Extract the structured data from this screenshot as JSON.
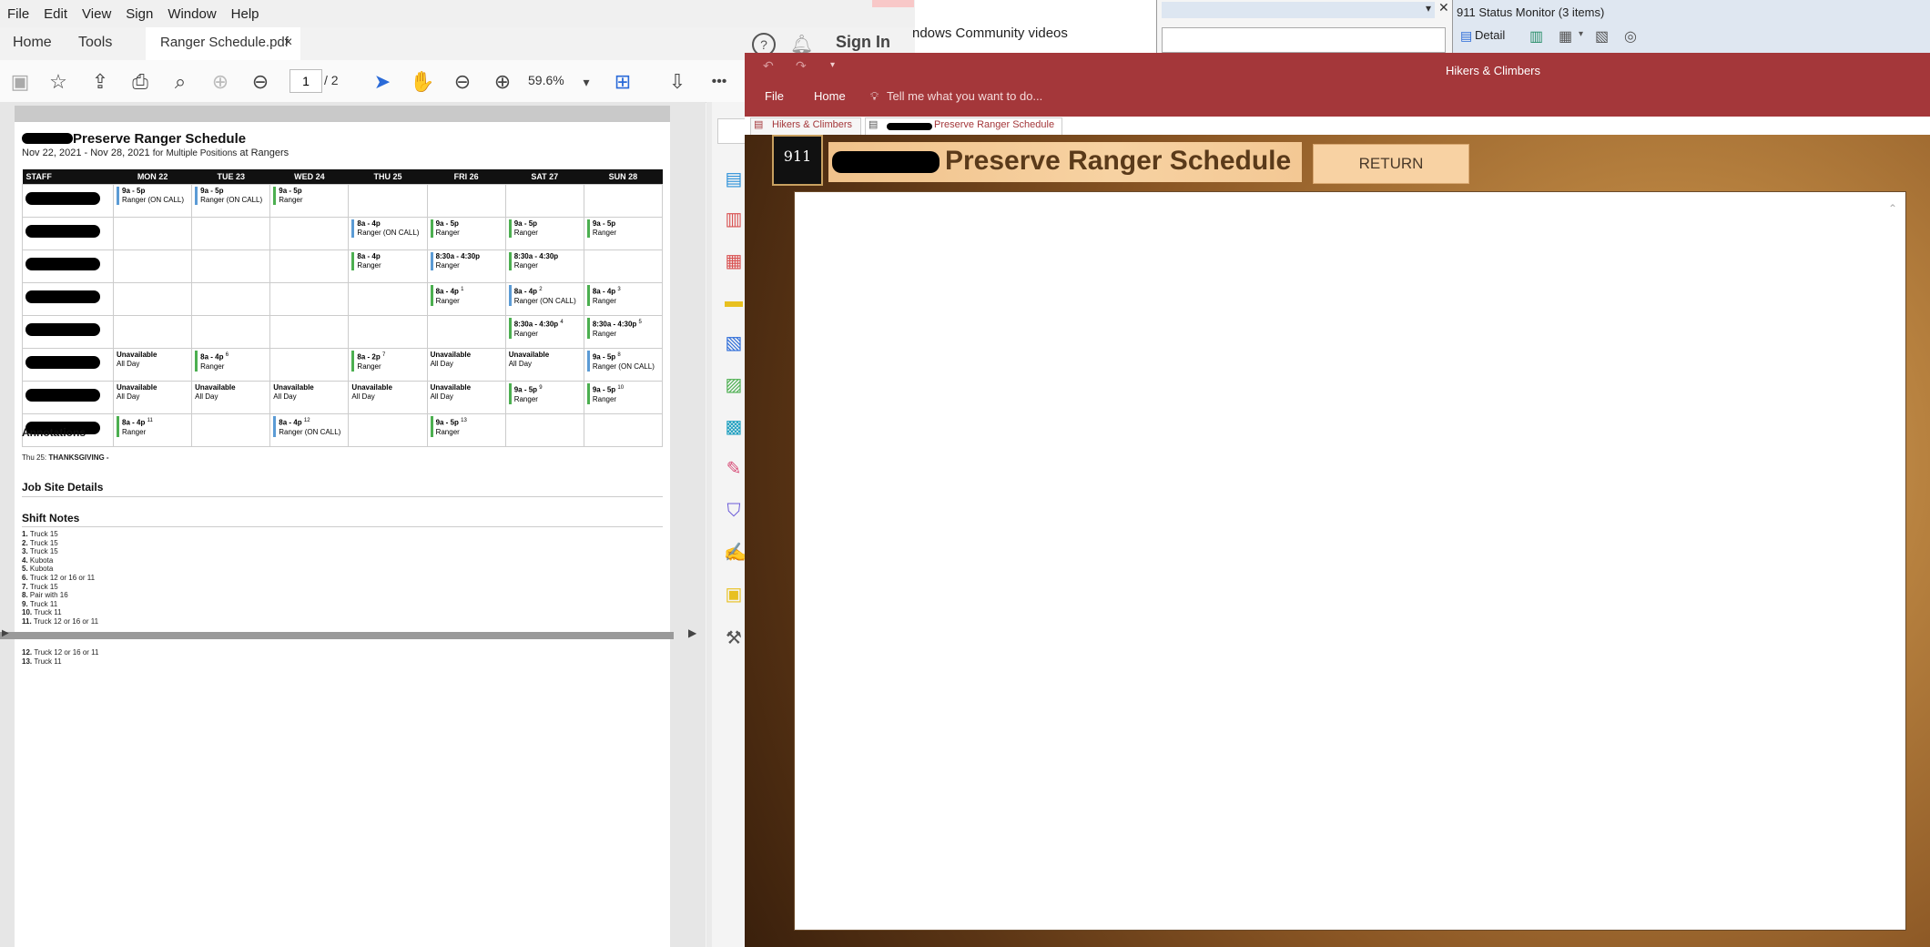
{
  "pdf_app": {
    "menu": [
      "File",
      "Edit",
      "View",
      "Sign",
      "Window",
      "Help"
    ],
    "tabs": {
      "home": "Home",
      "tools": "Tools",
      "document": "Ranger Schedule.pdf",
      "close": "×"
    },
    "sign_in": "Sign In",
    "page_current": "1",
    "page_total": "/ 2",
    "zoom": "59.6%",
    "more": "•••"
  },
  "schedule": {
    "title": "Preserve Ranger Schedule",
    "subtitle_dates": "Nov 22, 2021 - Nov 28, 2021",
    "subtitle_for": "for",
    "subtitle_positions": "Multiple Positions",
    "subtitle_at": "at",
    "subtitle_org": "Rangers",
    "headers": [
      "STAFF",
      "MON 22",
      "TUE 23",
      "WED 24",
      "THU 25",
      "FRI 26",
      "SAT 27",
      "SUN 28"
    ],
    "rows": [
      [
        [
          {
            "t": "9a - 5p",
            "r": "Ranger (ON CALL)",
            "c": "blue"
          }
        ],
        [
          {
            "t": "9a - 5p",
            "r": "Ranger (ON CALL)",
            "c": "blue"
          }
        ],
        [
          {
            "t": "9a - 5p",
            "r": "Ranger",
            "c": "green"
          }
        ],
        [],
        [],
        [],
        []
      ],
      [
        [],
        [],
        [],
        [
          {
            "t": "8a - 4p",
            "r": "Ranger (ON CALL)",
            "c": "blue"
          }
        ],
        [
          {
            "t": "9a - 5p",
            "r": "Ranger",
            "c": "green"
          }
        ],
        [
          {
            "t": "9a - 5p",
            "r": "Ranger",
            "c": "green"
          }
        ],
        [
          {
            "t": "9a - 5p",
            "r": "Ranger",
            "c": "green"
          }
        ]
      ],
      [
        [],
        [],
        [],
        [
          {
            "t": "8a - 4p",
            "r": "Ranger",
            "c": "green"
          }
        ],
        [
          {
            "t": "8:30a - 4:30p",
            "r": "Ranger",
            "c": "blue"
          }
        ],
        [
          {
            "t": "8:30a - 4:30p",
            "r": "Ranger",
            "c": "green"
          }
        ],
        []
      ],
      [
        [],
        [],
        [],
        [],
        [
          {
            "t": "8a - 4p",
            "s": "1",
            "r": "Ranger",
            "c": "green"
          }
        ],
        [
          {
            "t": "8a - 4p",
            "s": "2",
            "r": "Ranger (ON CALL)",
            "c": "blue"
          }
        ],
        [
          {
            "t": "8a - 4p",
            "s": "3",
            "r": "Ranger",
            "c": "green"
          }
        ]
      ],
      [
        [],
        [],
        [],
        [],
        [],
        [
          {
            "t": "8:30a - 4:30p",
            "s": "4",
            "r": "Ranger",
            "c": "green"
          }
        ],
        [
          {
            "t": "8:30a - 4:30p",
            "s": "5",
            "r": "Ranger",
            "c": "green"
          }
        ]
      ],
      [
        [
          {
            "t": "Unavailable",
            "r": "All Day",
            "c": "none"
          }
        ],
        [
          {
            "t": "8a - 4p",
            "s": "6",
            "r": "Ranger",
            "c": "green"
          }
        ],
        [],
        [
          {
            "t": "8a - 2p",
            "s": "7",
            "r": "Ranger",
            "c": "green"
          }
        ],
        [
          {
            "t": "Unavailable",
            "r": "All Day",
            "c": "none"
          }
        ],
        [
          {
            "t": "Unavailable",
            "r": "All Day",
            "c": "none"
          }
        ],
        [
          {
            "t": "9a - 5p",
            "s": "8",
            "r": "Ranger (ON CALL)",
            "c": "blue"
          }
        ]
      ],
      [
        [
          {
            "t": "Unavailable",
            "r": "All Day",
            "c": "none"
          }
        ],
        [
          {
            "t": "Unavailable",
            "r": "All Day",
            "c": "none"
          }
        ],
        [
          {
            "t": "Unavailable",
            "r": "All Day",
            "c": "none"
          }
        ],
        [
          {
            "t": "Unavailable",
            "r": "All Day",
            "c": "none"
          }
        ],
        [
          {
            "t": "Unavailable",
            "r": "All Day",
            "c": "none"
          }
        ],
        [
          {
            "t": "9a - 5p",
            "s": "9",
            "r": "Ranger",
            "c": "green"
          }
        ],
        [
          {
            "t": "9a - 5p",
            "s": "10",
            "r": "Ranger",
            "c": "green"
          }
        ]
      ],
      [
        [
          {
            "t": "8a - 4p",
            "s": "11",
            "r": "Ranger",
            "c": "green"
          }
        ],
        [],
        [
          {
            "t": "8a - 4p",
            "s": "12",
            "r": "Ranger (ON CALL)",
            "c": "blue"
          }
        ],
        [],
        [
          {
            "t": "9a - 5p",
            "s": "13",
            "r": "Ranger",
            "c": "green"
          }
        ],
        [],
        []
      ]
    ],
    "annotations_heading": "Annotations",
    "annotation_day": "Thu 25:",
    "annotation_text": "THANKSGIVING -",
    "job_site_heading": "Job Site Details",
    "shift_notes_heading": "Shift Notes",
    "notes": [
      "Truck 15",
      "Truck 15",
      "Truck 15",
      "Kubota",
      "Kubota",
      "Truck 12 or 16 or 11",
      "Truck 15",
      "Pair with 16",
      "Truck 11",
      "Truck 11",
      "Truck 12 or 16 or 11",
      "Truck 12 or 16 or 11",
      "Truck 11"
    ]
  },
  "background": {
    "win1_text": "ndows Community videos",
    "status_title": "911 Status Monitor (3 items)",
    "status_detail": "Detail"
  },
  "access": {
    "window_title": "Hikers & Climbers",
    "ribbon_file": "File",
    "ribbon_home": "Home",
    "tell_me": "Tell me what you want to do...",
    "tab1": "Hikers & Climbers",
    "tab2": "Preserve Ranger Schedule",
    "form_title": "Preserve Ranger Schedule",
    "logo_text": "911",
    "return_label": "RETURN"
  },
  "colors": {
    "access_brand": "#a4373a",
    "shift_green": "#4caf50",
    "shift_blue": "#5b9bd5"
  }
}
